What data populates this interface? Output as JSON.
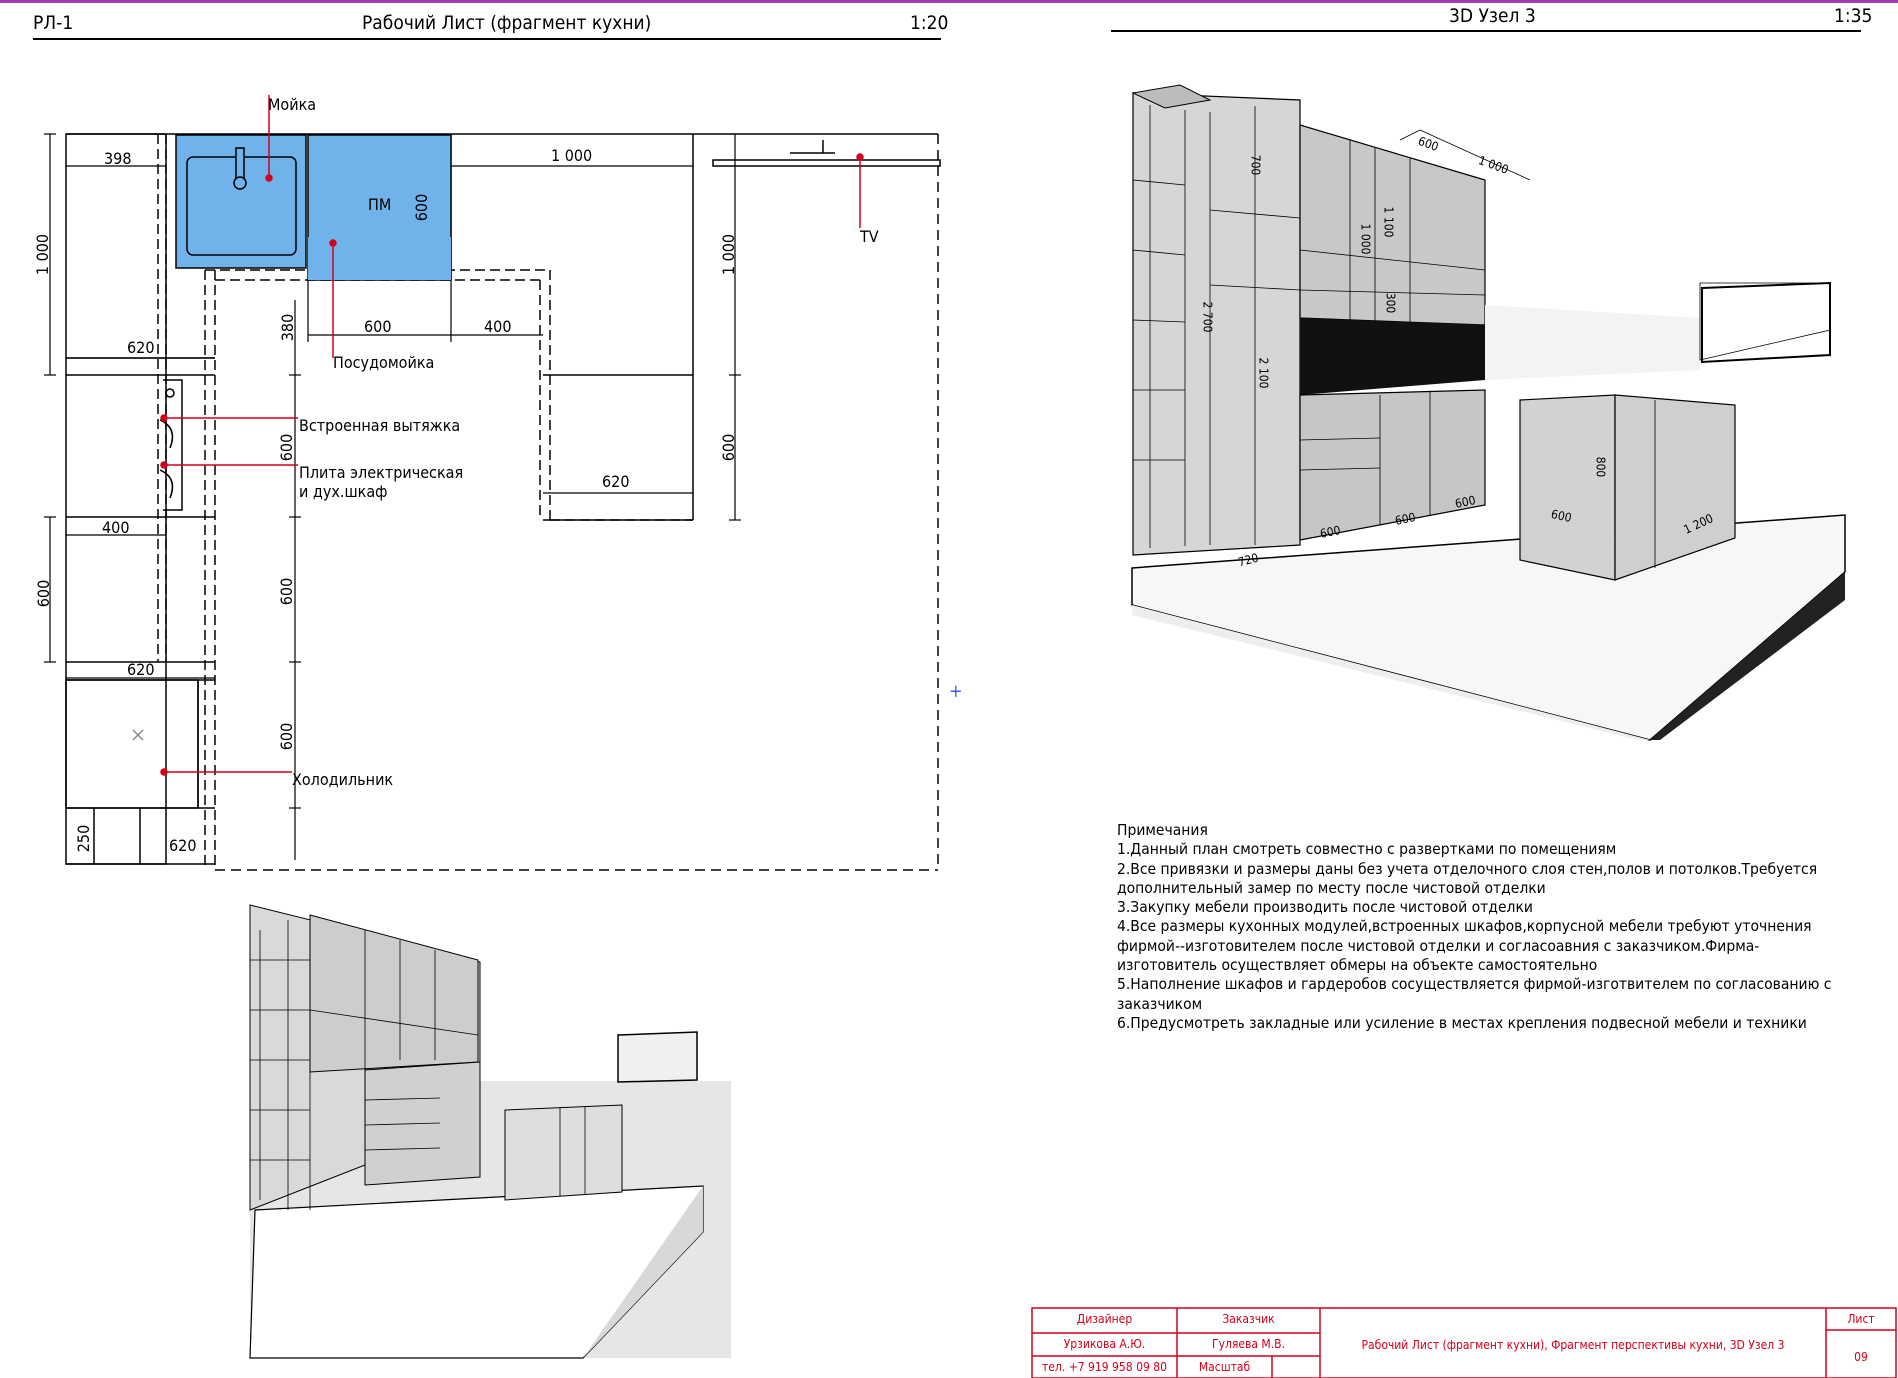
{
  "left_header": {
    "code": "РЛ-1",
    "title": "Рабочий Лист (фрагмент кухни)",
    "scale": "1:20"
  },
  "right_header": {
    "title": "3D Узел 3",
    "scale": "1:35"
  },
  "plan": {
    "callouts": {
      "sink": "Мойка",
      "tv": "TV",
      "dishwasher": "Посудомойка",
      "hood": "Встроенная вытяжка",
      "stove_line1": "Плита электрическая",
      "stove_line2": "и дух.шкаф",
      "fridge": "Холодильник",
      "pm": "ПМ"
    },
    "dims": {
      "d398": "398",
      "d1000_top": "1 000",
      "d1000_left": "1 000",
      "d1000_right": "1 000",
      "d600_pm": "600",
      "d620_a": "620",
      "d380": "380",
      "d600_b": "600",
      "d400_a": "400",
      "d600_c": "600",
      "d600_d": "600",
      "d620_b": "620",
      "d400_b": "400",
      "d600_e": "600",
      "d600_f": "600",
      "d620_c": "620",
      "d600_g": "600",
      "d250": "250",
      "d620_d": "620"
    }
  },
  "view3d_dims": {
    "d600_top": "600",
    "d1000_top": "1 000",
    "d700": "700",
    "d1100": "1 100",
    "d1000_b": "1 000",
    "d300": "300",
    "d2700": "2 700",
    "d2100": "2 100",
    "d800": "800",
    "d600_base1": "600",
    "d600_base2": "600",
    "d600_base3": "600",
    "d600_base4": "600",
    "d1200": "1 200",
    "d720": "720"
  },
  "notes": {
    "title": "Примечания",
    "items": [
      "1.Данный план смотреть совместно с развертками по помещениям",
      "2.Все привязки и размеры даны без учета отделочного слоя стен,полов и потолков.Требуется дополнительный замер по месту после чистовой отделки",
      "3.Закупку мебели производить после чистовой отделки",
      "4.Все размеры кухонных модулей,встроенных шкафов,корпусной мебели требуют уточнения фирмой--изготовителем после чистовой отделки и согласоавния с заказчиком.Фирма-изготовитель осуществляет обмеры на объекте самостоятельно",
      "5.Наполнение шкафов и гардеробов сосуществляется фирмой-изготвителем по согласованию с заказчиком",
      "6.Предусмотреть закладные или усиление в местах крепления подвесной мебели и техники"
    ]
  },
  "stamp": {
    "designer_label": "Дизайнер",
    "designer_name": "Урзикова А.Ю.",
    "designer_phone": "тел. +7 919 958 09 80",
    "customer_label": "Заказчик",
    "customer_name": "Гуляева М.В.",
    "scale_label": "Масштаб",
    "sheet_title": "Рабочий Лист (фрагмент кухни), Фрагмент перспективы кухни, 3D Узел 3",
    "sheet_label": "Лист",
    "sheet_number": "09"
  },
  "colors": {
    "accent_blue": "#6fb3ea",
    "leader_red": "#d4001a",
    "stamp_red": "#d4001a",
    "top_line": "#a23bb0"
  }
}
